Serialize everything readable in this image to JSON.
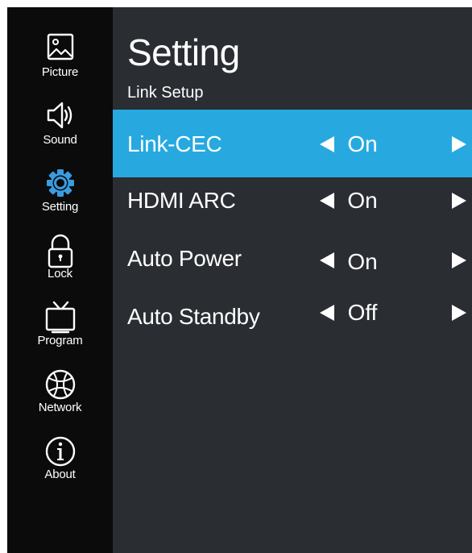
{
  "sidebar": {
    "items": [
      {
        "label": "Picture",
        "icon": "picture-icon"
      },
      {
        "label": "Sound",
        "icon": "sound-icon"
      },
      {
        "label": "Setting",
        "icon": "gear-icon",
        "active": true
      },
      {
        "label": "Lock",
        "icon": "lock-icon"
      },
      {
        "label": "Program",
        "icon": "tv-icon"
      },
      {
        "label": "Network",
        "icon": "globe-icon"
      },
      {
        "label": "About",
        "icon": "info-icon"
      }
    ]
  },
  "header": {
    "title": "Setting",
    "subtitle": "Link Setup"
  },
  "settings": [
    {
      "label": "Link-CEC",
      "value": "On",
      "selected": true
    },
    {
      "label": "HDMI ARC",
      "value": "On",
      "selected": false
    },
    {
      "label": "Auto Power",
      "value": "On",
      "selected": false
    },
    {
      "label": "Auto Standby",
      "value": "Off",
      "selected": false
    }
  ],
  "colors": {
    "background": "#2a2d32",
    "sidebar": "#0b0b0b",
    "highlight": "#27a9e0",
    "active_icon": "#3a9be0",
    "text": "#ffffff"
  }
}
